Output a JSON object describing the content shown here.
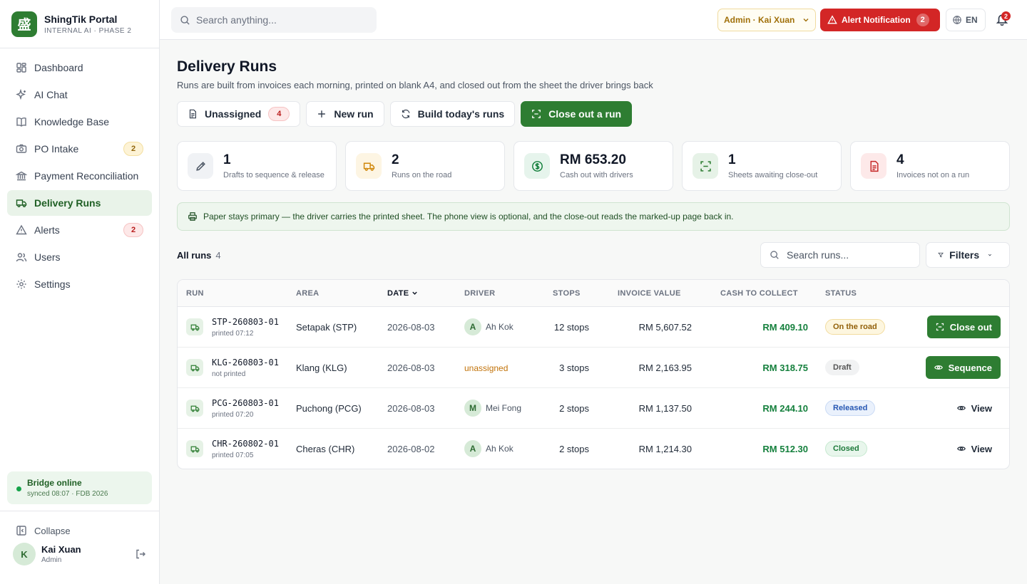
{
  "brand": {
    "name": "ShingTik Portal",
    "sub": "INTERNAL AI · PHASE 2",
    "logo_glyph": "盛"
  },
  "sidebar": {
    "items": [
      {
        "label": "Dashboard",
        "icon": "dashboard-icon"
      },
      {
        "label": "AI Chat",
        "icon": "sparkle-icon"
      },
      {
        "label": "Knowledge Base",
        "icon": "book-icon"
      },
      {
        "label": "PO Intake",
        "icon": "camera-icon",
        "badge": "2"
      },
      {
        "label": "Payment Reconciliation",
        "icon": "bank-icon"
      },
      {
        "label": "Delivery Runs",
        "icon": "truck-icon"
      },
      {
        "label": "Alerts",
        "icon": "alert-icon",
        "badge": "2"
      },
      {
        "label": "Users",
        "icon": "users-icon"
      },
      {
        "label": "Settings",
        "icon": "gear-icon"
      }
    ],
    "bridge": {
      "title": "Bridge online",
      "sub": "synced 08:07 · FDB 2026"
    },
    "collapse_label": "Collapse",
    "user": {
      "initial": "K",
      "name": "Kai Xuan",
      "role": "Admin"
    }
  },
  "topbar": {
    "search_placeholder": "Search anything...",
    "role": "Admin · Kai Xuan",
    "alert_label": "Alert Notification",
    "alert_count": "2",
    "lang": "EN",
    "bell_count": "2"
  },
  "page": {
    "title": "Delivery Runs",
    "subtitle": "Runs are built from invoices each morning, printed on blank A4, and closed out from the sheet the driver brings back"
  },
  "actions": {
    "unassigned": "Unassigned",
    "unassigned_count": "4",
    "new_run": "New run",
    "build": "Build today's runs",
    "close_out": "Close out a run"
  },
  "stats": [
    {
      "value": "1",
      "label": "Drafts to sequence & release"
    },
    {
      "value": "2",
      "label": "Runs on the road"
    },
    {
      "value": "RM 653.20",
      "label": "Cash out with drivers"
    },
    {
      "value": "1",
      "label": "Sheets awaiting close-out"
    },
    {
      "value": "4",
      "label": "Invoices not on a run"
    }
  ],
  "notice": "Paper stays primary — the driver carries the printed sheet. The phone view is optional, and the close-out reads the marked-up page back in.",
  "list": {
    "title": "All runs",
    "count": "4",
    "search_placeholder": "Search runs...",
    "filters": "Filters"
  },
  "table": {
    "columns": {
      "run": "Run",
      "area": "Area",
      "date": "Date",
      "driver": "Driver",
      "stops": "Stops",
      "invoice": "Invoice value",
      "cash": "Cash to collect",
      "status": "Status"
    },
    "rows": [
      {
        "id": "STP-260803-01",
        "sub": "printed 07:12",
        "area": "Setapak (STP)",
        "date": "2026-08-03",
        "driver_initial": "A",
        "driver": "Ah Kok",
        "stops": "12 stops",
        "invoice": "RM 5,607.52",
        "cash": "RM 409.10",
        "status": "On the road",
        "action": "Close out"
      },
      {
        "id": "KLG-260803-01",
        "sub": "not printed",
        "area": "Klang (KLG)",
        "date": "2026-08-03",
        "driver_initial": "",
        "driver": "unassigned",
        "stops": "3 stops",
        "invoice": "RM 2,163.95",
        "cash": "RM 318.75",
        "status": "Draft",
        "action": "Sequence"
      },
      {
        "id": "PCG-260803-01",
        "sub": "printed 07:20",
        "area": "Puchong (PCG)",
        "date": "2026-08-03",
        "driver_initial": "M",
        "driver": "Mei Fong",
        "stops": "2 stops",
        "invoice": "RM 1,137.50",
        "cash": "RM 244.10",
        "status": "Released",
        "action": "View"
      },
      {
        "id": "CHR-260802-01",
        "sub": "printed 07:05",
        "area": "Cheras (CHR)",
        "date": "2026-08-02",
        "driver_initial": "A",
        "driver": "Ah Kok",
        "stops": "2 stops",
        "invoice": "RM 1,214.30",
        "cash": "RM 512.30",
        "status": "Closed",
        "action": "View"
      }
    ]
  },
  "colors": {
    "brand_green": "#2e7d32",
    "alert_red": "#d32626",
    "cash_green": "#15803d"
  }
}
